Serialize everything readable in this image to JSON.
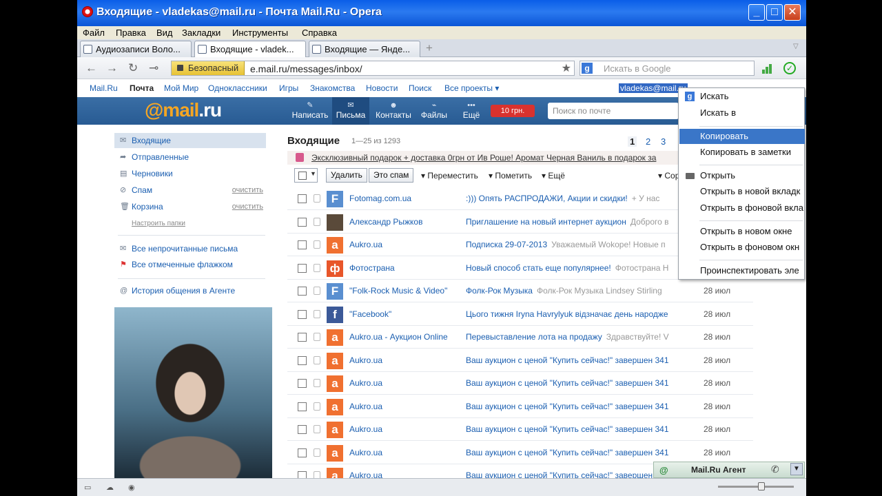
{
  "window": {
    "title": "Входящие - vladekas@mail.ru - Почта Mail.Ru - Opera"
  },
  "menu": [
    "Файл",
    "Правка",
    "Вид",
    "Закладки",
    "Инструменты",
    "Справка"
  ],
  "tabs": [
    {
      "label": "Аудиозаписи Воло..."
    },
    {
      "label": "Входящие - vladek..."
    },
    {
      "label": "Входящие — Янде..."
    }
  ],
  "address": {
    "secure_label": "Безопасный",
    "url": "e.mail.ru/messages/inbox/",
    "search_placeholder": "Искать в Google"
  },
  "portal": {
    "links": [
      "Mail.Ru",
      "Почта",
      "Мой Мир",
      "Одноклассники",
      "Игры",
      "Знакомства",
      "Новости",
      "Поиск",
      "Все проекты ▾"
    ],
    "user": "vladekas@mail.ru"
  },
  "mailheader": {
    "logo_prefix": "@mail",
    "logo_suffix": ".ru",
    "buttons": [
      "Написать",
      "Письма",
      "Контакты",
      "Файлы",
      "Ещё"
    ],
    "money": "10 грн.",
    "search_placeholder": "Поиск по почте"
  },
  "sidebar": {
    "folders": [
      {
        "label": "Входящие",
        "action": ""
      },
      {
        "label": "Отправленные",
        "action": ""
      },
      {
        "label": "Черновики",
        "action": ""
      },
      {
        "label": "Спам",
        "action": "очистить"
      },
      {
        "label": "Корзина",
        "action": "очистить"
      }
    ],
    "settings_link": "Настроить папки",
    "filters": [
      "Все непрочитанные письма",
      "Все отмеченные флажком"
    ],
    "agent_history": "История общения в Агенте"
  },
  "content": {
    "title": "Входящие",
    "count": "1—25 из 1293",
    "pages": [
      "1",
      "2",
      "3"
    ],
    "promo": "Эксклюзивный подарок + доставка 0грн от Ив Роше! Аромат Черная Ваниль в подарок за",
    "toolbar": {
      "delete": "Удалить",
      "spam": "Это спам",
      "move": "Переместить",
      "mark": "Пометить",
      "more": "Ещё",
      "sort": "Сор"
    }
  },
  "messages": [
    {
      "from": "Fotomag.com.ua",
      "subject": ":))) Опять РАСПРОДАЖИ, Акции и скидки!",
      "snippet": "+ У нас",
      "date": "",
      "avatar": "F",
      "color": "#5a8fd0"
    },
    {
      "from": "Александр Рыжков",
      "subject": "Приглашение на новый интернет аукцион",
      "snippet": "Доброго в",
      "date": "",
      "avatar": "",
      "color": "#5a4a3a"
    },
    {
      "from": "Aukro.ua",
      "subject": "Подписка 29-07-2013",
      "snippet": "Уважаемый Wokope! Новые п",
      "date": "",
      "avatar": "a",
      "color": "#f07030"
    },
    {
      "from": "Фотострана",
      "subject": "Новый способ стать еще популярнее!",
      "snippet": "Фотострана Н",
      "date": "",
      "avatar": "ф",
      "color": "#e8562a"
    },
    {
      "from": "\"Folk-Rock Music & Video\"",
      "subject": "Фолк-Рок Музыка",
      "snippet": "Фолк-Рок Музыка Lindsey Stirling",
      "date": "28 июл",
      "avatar": "F",
      "color": "#5a8fd0"
    },
    {
      "from": "\"Facebook\"",
      "subject": "Цього тижня Iryna Havrylyuk відзначає день народже",
      "snippet": "",
      "date": "28 июл",
      "avatar": "f",
      "color": "#3b5998"
    },
    {
      "from": "Aukro.ua - Аукцион Online",
      "subject": "Перевыставление лота на продажу",
      "snippet": "Здравствуйте! V",
      "date": "28 июл",
      "avatar": "a",
      "color": "#f07030"
    },
    {
      "from": "Aukro.ua",
      "subject": "Ваш аукцион с ценой \"Купить сейчас!\" завершен 341",
      "snippet": "",
      "date": "28 июл",
      "avatar": "a",
      "color": "#f07030"
    },
    {
      "from": "Aukro.ua",
      "subject": "Ваш аукцион с ценой \"Купить сейчас!\" завершен 341",
      "snippet": "",
      "date": "28 июл",
      "avatar": "a",
      "color": "#f07030"
    },
    {
      "from": "Aukro.ua",
      "subject": "Ваш аукцион с ценой \"Купить сейчас!\" завершен 341",
      "snippet": "",
      "date": "28 июл",
      "avatar": "a",
      "color": "#f07030"
    },
    {
      "from": "Aukro.ua",
      "subject": "Ваш аукцион с ценой \"Купить сейчас!\" завершен 341",
      "snippet": "",
      "date": "28 июл",
      "avatar": "a",
      "color": "#f07030"
    },
    {
      "from": "Aukro.ua",
      "subject": "Ваш аукцион с ценой \"Купить сейчас!\" завершен 341",
      "snippet": "",
      "date": "28 июл",
      "avatar": "a",
      "color": "#f07030"
    },
    {
      "from": "Aukro.ua",
      "subject": "Ваш аукцион с ценой \"Купить сейчас!\" завершен 341",
      "snippet": "",
      "date": "28 июл",
      "avatar": "a",
      "color": "#f07030"
    }
  ],
  "context_menu": {
    "items": [
      "Искать",
      "Искать в",
      "Копировать",
      "Копировать в заметки",
      "Открыть",
      "Открыть в новой вкладк",
      "Открыть в фоновой вкла",
      "Открыть в новом окне",
      "Открыть в фоновом окн",
      "Проинспектировать эле"
    ],
    "highlighted": 2
  },
  "agent": {
    "label": "Mail.Ru Агент"
  }
}
